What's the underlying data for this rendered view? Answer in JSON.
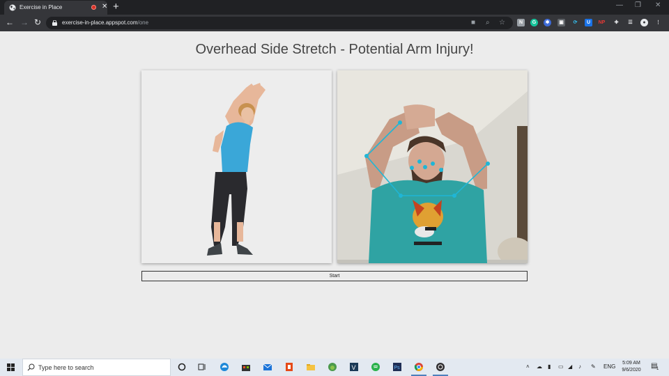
{
  "browser": {
    "tab_title": "Exercise in Place",
    "new_tab": "+",
    "url_host": "exercise-in-place.appspot.com",
    "url_path": "/one"
  },
  "page": {
    "title": "Overhead Side Stretch - Potential Arm Injury!",
    "start_label": "Start"
  },
  "taskbar": {
    "search_placeholder": "Type here to search",
    "language": "ENG",
    "time": "5:09 AM",
    "date": "9/6/2020",
    "notification_count": "1"
  },
  "icons": {
    "extensions": [
      "N",
      "U",
      "NP"
    ]
  },
  "colors": {
    "pose_skeleton": "#1fb6d6",
    "shirt": "#3aa7d8",
    "page_bg": "#ececec"
  }
}
